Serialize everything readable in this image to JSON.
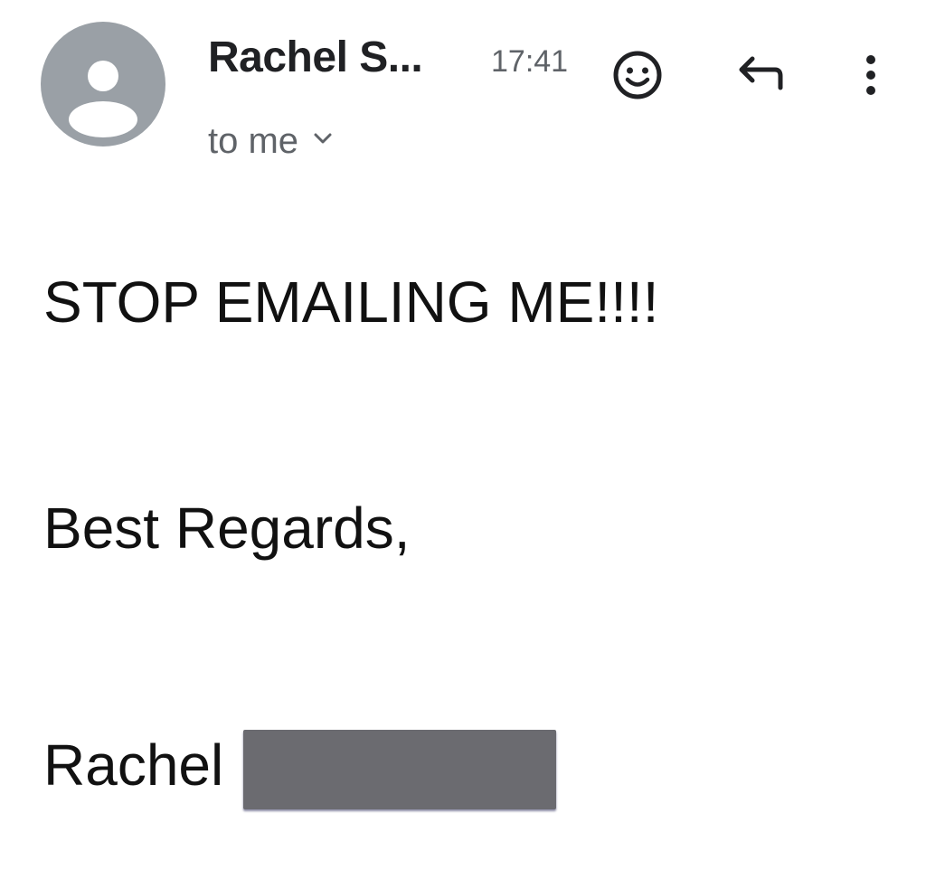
{
  "header": {
    "sender_name": "Rachel S...",
    "time": "17:41",
    "recipient_label": "to me",
    "icons": {
      "avatar": "person-avatar-icon",
      "emoji": "smiley-face-icon",
      "reply": "reply-arrow-icon",
      "more": "more-vertical-icon",
      "expand": "chevron-down-icon"
    },
    "avatar_color": "#9aa0a6"
  },
  "body": {
    "main_text": "STOP EMAILING ME!!!!",
    "closing": "Best Regards,",
    "signature_first_name": "Rachel"
  }
}
